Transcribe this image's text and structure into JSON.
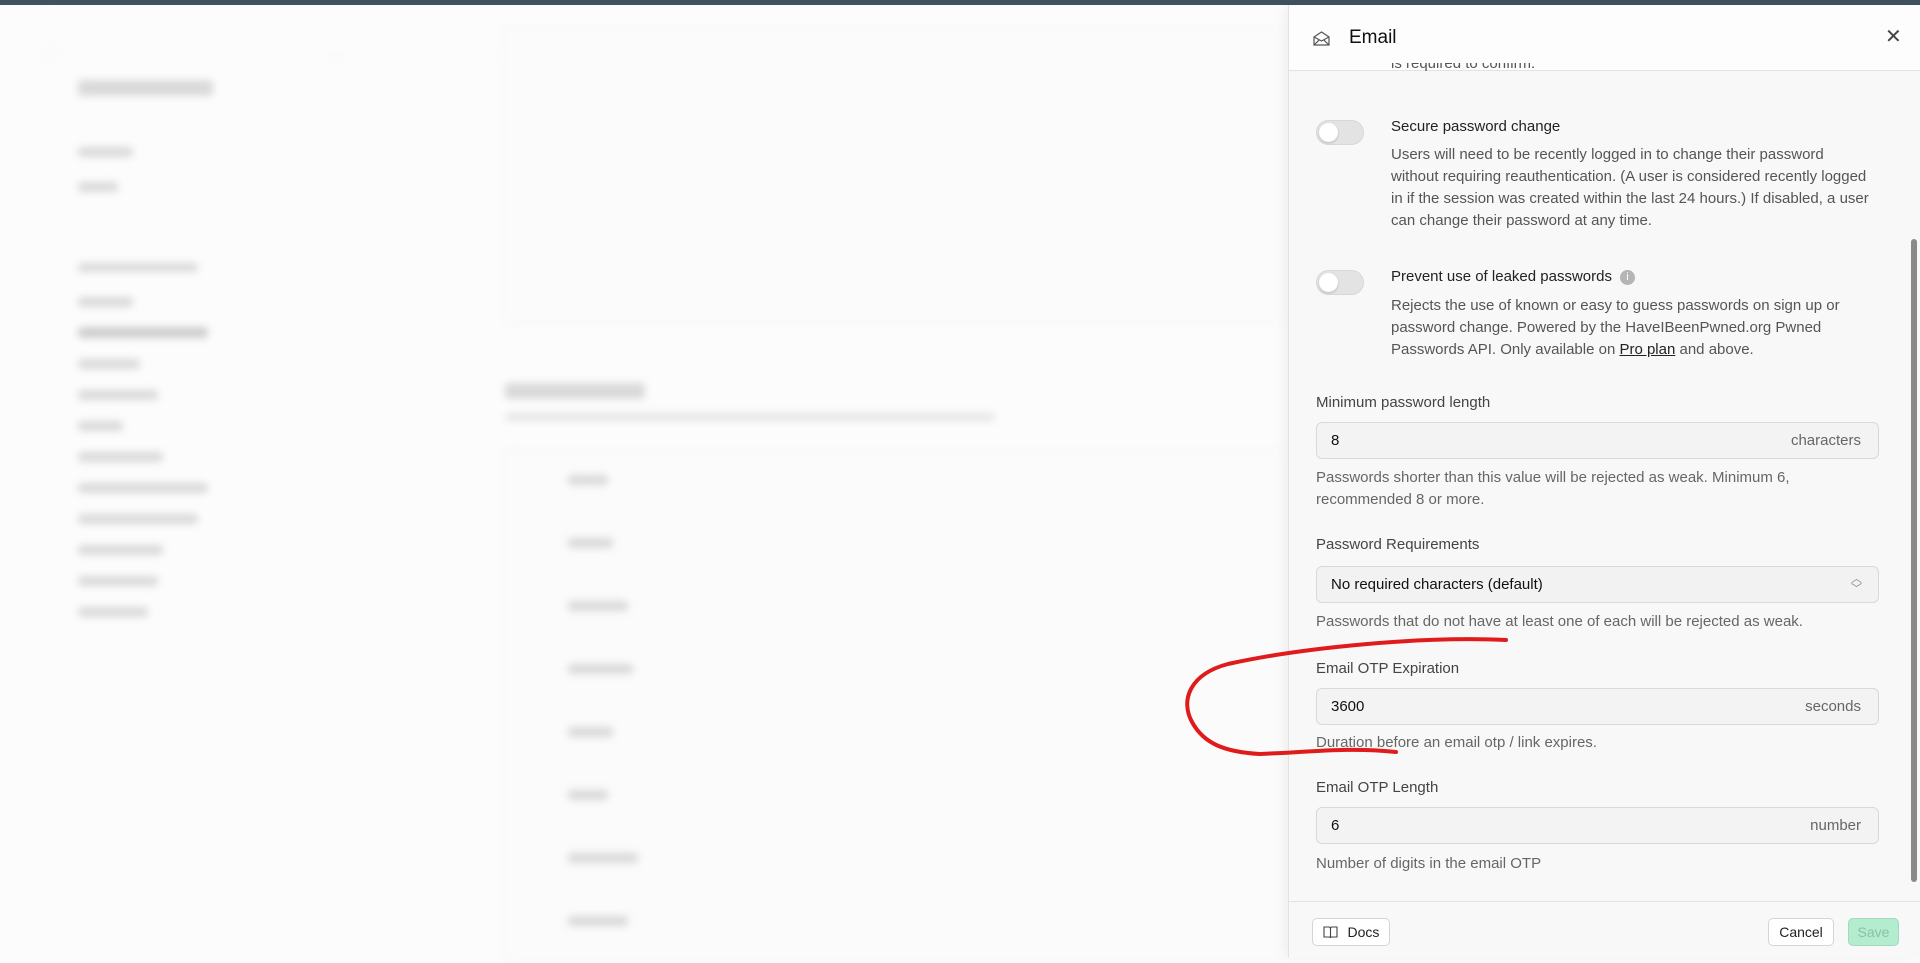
{
  "panel": {
    "title": "Email",
    "cut_text": "is required to confirm.",
    "secure_password_change": {
      "title": "Secure password change",
      "enabled": false,
      "description": "Users will need to be recently logged in to change their password without requiring reauthentication. (A user is considered recently logged in if the session was created within the last 24 hours.) If disabled, a user can change their password at any time."
    },
    "leaked_passwords": {
      "title": "Prevent use of leaked passwords",
      "enabled": false,
      "description_pre": "Rejects the use of known or easy to guess passwords on sign up or password change. Powered by the HaveIBeenPwned.org Pwned Passwords API. Only available on ",
      "link": "Pro plan",
      "description_post": " and above."
    },
    "min_length": {
      "label": "Minimum password length",
      "value": "8",
      "unit": "characters",
      "help": "Passwords shorter than this value will be rejected as weak. Minimum 6, recommended 8 or more."
    },
    "requirements": {
      "label": "Password Requirements",
      "value": "No required characters (default)",
      "help": "Passwords that do not have at least one of each will be rejected as weak."
    },
    "otp_expiration": {
      "label": "Email OTP Expiration",
      "value": "3600",
      "unit": "seconds",
      "help": "Duration before an email otp / link expires."
    },
    "otp_length": {
      "label": "Email OTP Length",
      "value": "6",
      "unit": "number",
      "help": "Number of digits in the email OTP"
    },
    "footer": {
      "docs": "Docs",
      "cancel": "Cancel",
      "save": "Save"
    }
  },
  "colors": {
    "annotation": "#e01b1b",
    "save_bg": "#b4ecd0",
    "save_text": "#86c4a3"
  }
}
